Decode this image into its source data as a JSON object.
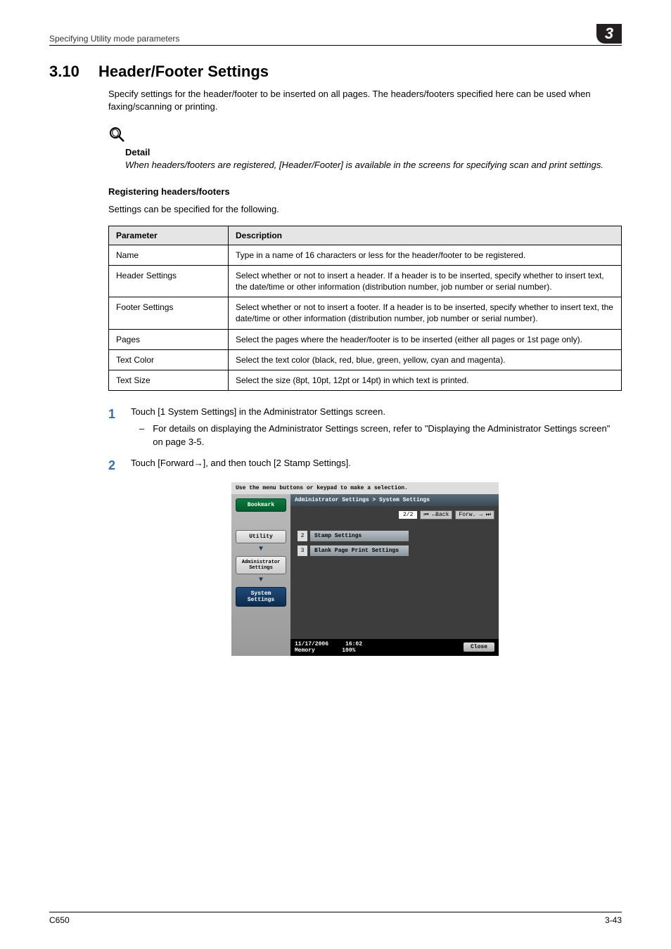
{
  "header": {
    "left": "Specifying Utility mode parameters",
    "badge": "3"
  },
  "section": {
    "number": "3.10",
    "title": "Header/Footer Settings"
  },
  "intro": "Specify settings for the header/footer to be inserted on all pages. The headers/footers specified here can be used when faxing/scanning or printing.",
  "detail": {
    "label": "Detail",
    "text": "When headers/footers are registered, [Header/Footer] is available in the screens for specifying scan and print settings."
  },
  "subhead": "Registering headers/footers",
  "subintro": "Settings can be specified for the following.",
  "table": {
    "headers": [
      "Parameter",
      "Description"
    ],
    "rows": [
      [
        "Name",
        "Type in a name of 16 characters or less for the header/footer to be registered."
      ],
      [
        "Header Settings",
        "Select whether or not to insert a header. If a header is to be inserted, specify whether to insert text, the date/time or other information (distribution number, job number or serial number)."
      ],
      [
        "Footer Settings",
        "Select whether or not to insert a footer. If a header is to be inserted, specify whether to insert text, the date/time or other information (distribution number, job number or serial number)."
      ],
      [
        "Pages",
        "Select the pages where the header/footer is to be inserted (either all pages or 1st page only)."
      ],
      [
        "Text Color",
        "Select the text color (black, red, blue, green, yellow, cyan and magenta)."
      ],
      [
        "Text Size",
        "Select the size (8pt, 10pt, 12pt or 14pt) in which text is printed."
      ]
    ]
  },
  "steps": [
    {
      "num": "1",
      "text": "Touch [1 System Settings] in the Administrator Settings screen.",
      "sub": "For details on displaying the Administrator Settings screen, refer to \"Displaying the Administrator Settings screen\" on page 3-5."
    },
    {
      "num": "2",
      "text": "Touch [Forward→], and then touch [2 Stamp Settings]."
    }
  ],
  "screenshot": {
    "instruction": "Use the menu buttons or keypad to make a selection.",
    "crumb": "Administrator Settings > System Settings",
    "page": "2/2",
    "back": "⏮ ←Back",
    "forward": "Forw. → ⏭",
    "sidebar": {
      "bookmark": "Bookmark",
      "utility": "Utility",
      "admin": "Administrator Settings",
      "system": "System Settings"
    },
    "menu": [
      {
        "n": "2",
        "label": "Stamp Settings"
      },
      {
        "n": "3",
        "label": "Blank Page Print Settings"
      }
    ],
    "status_date": "11/17/2006",
    "status_time": "16:02",
    "status_mem": "Memory",
    "status_pct": "100%",
    "close": "Close"
  },
  "footer": {
    "left": "C650",
    "right": "3-43"
  }
}
